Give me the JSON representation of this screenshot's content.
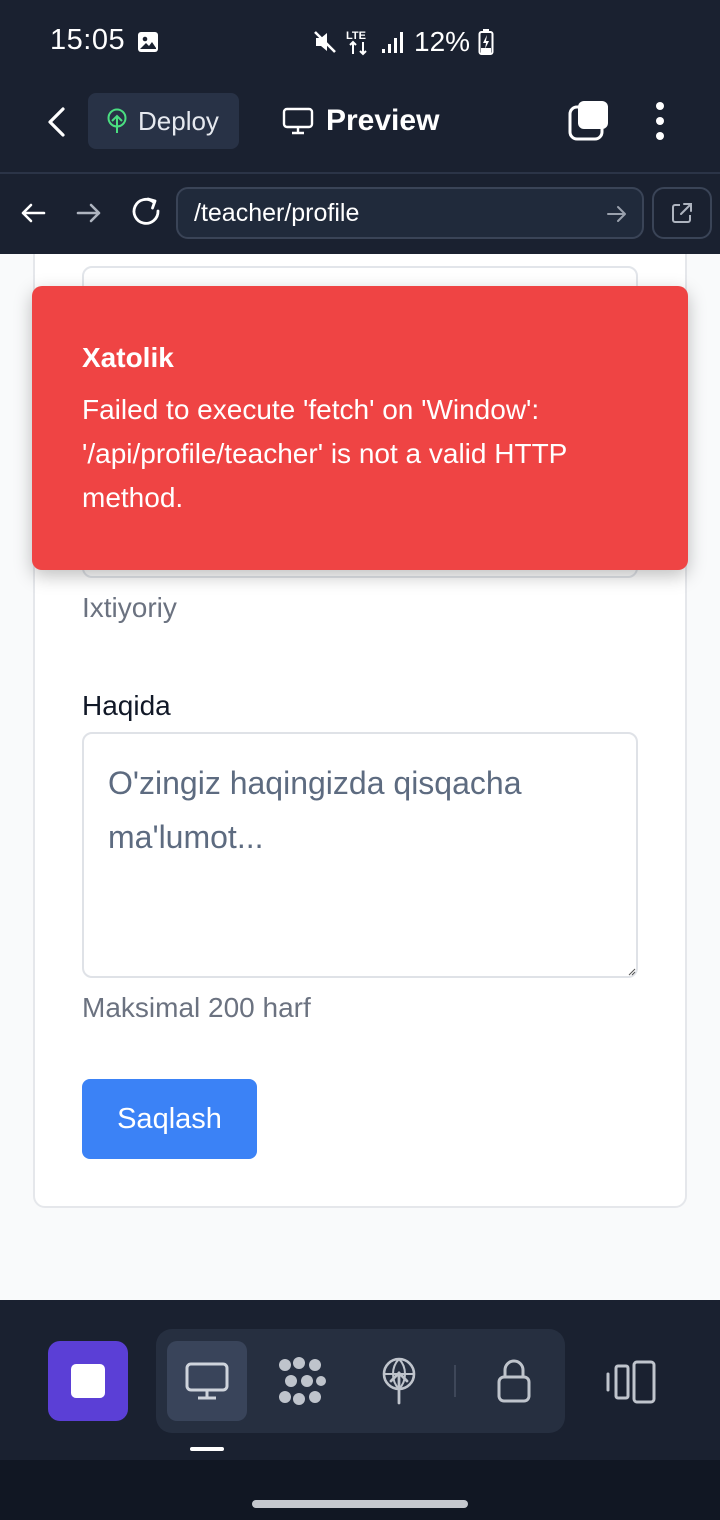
{
  "status_bar": {
    "time": "15:05",
    "battery": "12%",
    "icons": [
      "image-icon",
      "mute-icon",
      "lte-icon",
      "signal-icon",
      "battery-charging-icon"
    ]
  },
  "header": {
    "deploy_label": "Deploy",
    "preview_label": "Preview"
  },
  "browser": {
    "url": "/teacher/profile"
  },
  "form": {
    "optional_hint": "Ixtiyoriy",
    "about_label": "Haqida",
    "about_placeholder": "O'zingiz haqingizda qisqacha ma'lumot...",
    "about_value": "",
    "max_hint": "Maksimal 200 harf",
    "save_label": "Saqlash"
  },
  "toast": {
    "title": "Xatolik",
    "message": "Failed to execute 'fetch' on 'Window': '/api/profile/teacher' is not a valid HTTP method."
  },
  "colors": {
    "background_dark": "#1a2130",
    "toast_red": "#ef4444",
    "primary_blue": "#3b82f6",
    "stop_purple": "#5b3fd6"
  },
  "toolbar": {
    "tools": [
      "desktop-icon",
      "workflow-icon",
      "deploy-icon",
      "lock-icon"
    ],
    "active_tool": "desktop-icon"
  }
}
